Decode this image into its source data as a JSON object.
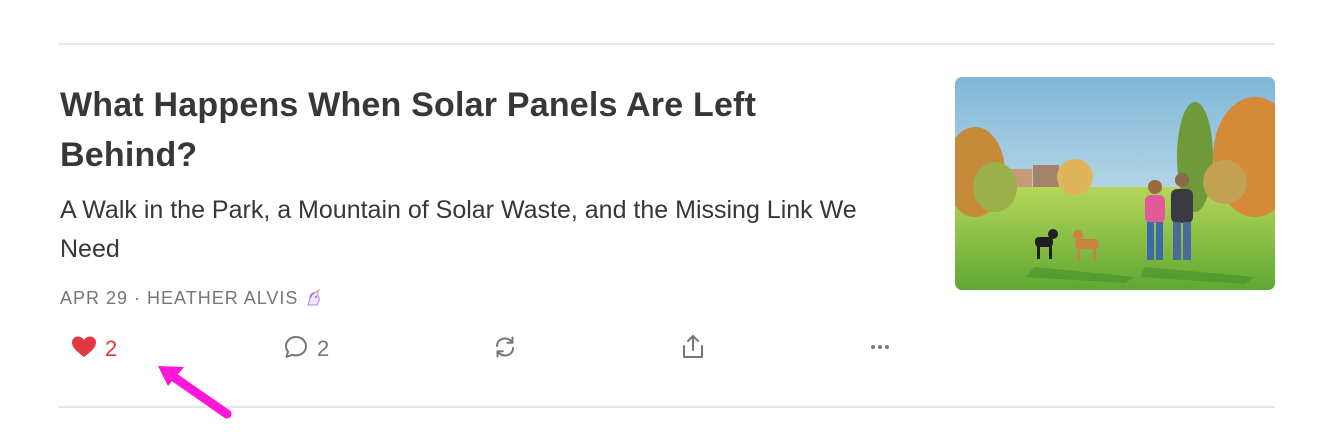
{
  "post": {
    "title": "What Happens When Solar Panels Are Left Behind?",
    "subtitle": "A Walk in the Park, a Mountain of Solar Waste, and the Missing Link We Need",
    "date": "APR 29",
    "separator": "·",
    "author": "HEATHER ALVIS",
    "author_badge_icon": "unicorn-icon",
    "thumbnail_alt": "Watercolor of a couple walking two dogs in a park"
  },
  "actions": {
    "like_count": "2",
    "comment_count": "2",
    "like_icon": "heart-icon",
    "comment_icon": "comment-bubble-icon",
    "restack_icon": "restack-icon",
    "share_icon": "share-icon",
    "more_icon": "ellipsis-icon"
  },
  "colors": {
    "like": "#e0383e",
    "text": "#363737",
    "muted": "#777777",
    "annotation": "#ff17d9"
  }
}
